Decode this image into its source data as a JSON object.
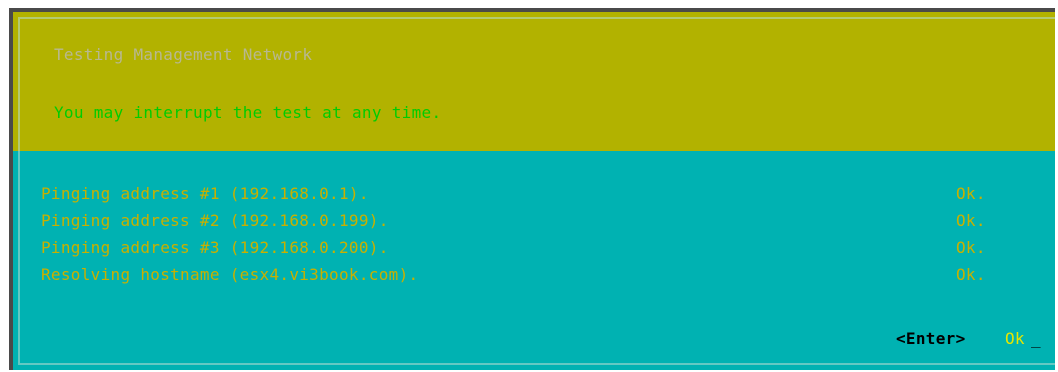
{
  "dialog": {
    "title": "Testing Management Network",
    "subtitle": "You may interrupt the test at any time."
  },
  "results": [
    {
      "text": "Pinging address #1 (192.168.0.1).",
      "status": "Ok."
    },
    {
      "text": "Pinging address #2 (192.168.0.199).",
      "status": "Ok."
    },
    {
      "text": "Pinging address #3 (192.168.0.200).",
      "status": "Ok."
    },
    {
      "text": "Resolving hostname (esx4.vi3book.com).",
      "status": "Ok."
    }
  ],
  "footer": {
    "enter_key": "<Enter>",
    "ok_label": "Ok",
    "cursor": "_"
  },
  "colors": {
    "header_bg": "#b2b200",
    "body_bg": "#00b2b2",
    "result_text": "#c8b000",
    "subtitle_text": "#00cc00"
  }
}
